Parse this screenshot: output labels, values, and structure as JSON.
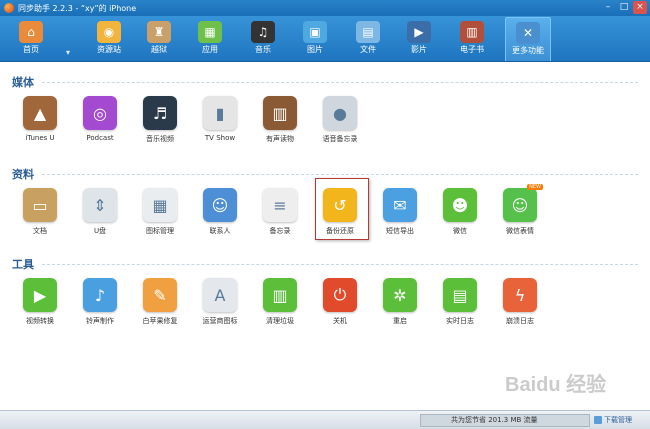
{
  "window": {
    "title": "同步助手 2.2.3 - “xy”的 iPhone",
    "min": "–",
    "max": "□",
    "close": "×"
  },
  "toolbar": {
    "items": [
      {
        "label": "首页",
        "icon": "home-icon",
        "color": "#e98b3a",
        "glyph": "⌂"
      },
      {
        "label": "资源站",
        "icon": "store-icon",
        "color": "#f2b43c",
        "glyph": "◉"
      },
      {
        "label": "越狱",
        "icon": "jailbreak-icon",
        "color": "#c9a06a",
        "glyph": "♜"
      },
      {
        "label": "应用",
        "icon": "apps-icon",
        "color": "#6fbf4b",
        "glyph": "▦"
      },
      {
        "label": "音乐",
        "icon": "music-icon",
        "color": "#333333",
        "glyph": "♫"
      },
      {
        "label": "图片",
        "icon": "photo-icon",
        "color": "#4fa9e0",
        "glyph": "▣"
      },
      {
        "label": "文件",
        "icon": "folder-icon",
        "color": "#7db7e6",
        "glyph": "▤"
      },
      {
        "label": "影片",
        "icon": "video-icon",
        "color": "#3b6ea8",
        "glyph": "▶"
      },
      {
        "label": "电子书",
        "icon": "ebook-icon",
        "color": "#b0503a",
        "glyph": "▥"
      },
      {
        "label": "更多功能",
        "icon": "more-tools-icon",
        "color": "#4a8fd0",
        "glyph": "✕"
      }
    ],
    "dropdown": "▾"
  },
  "sections": [
    {
      "title": "媒体",
      "tiles": [
        {
          "label": "iTunes U",
          "icon": "itunes-u-icon",
          "color": "#a0673a",
          "glyph": "▲"
        },
        {
          "label": "Podcast",
          "icon": "podcast-icon",
          "color": "#a34ad0",
          "glyph": "◎"
        },
        {
          "label": "音乐视频",
          "icon": "music-video-icon",
          "color": "#2b3a4a",
          "glyph": "♬"
        },
        {
          "label": "TV Show",
          "icon": "tv-show-icon",
          "color": "#e5e5e5",
          "glyph": "▮"
        },
        {
          "label": "有声读物",
          "icon": "audiobook-icon",
          "color": "#8a5a35",
          "glyph": "▥"
        },
        {
          "label": "语音备忘录",
          "icon": "voice-memo-icon",
          "color": "#cfd6dd",
          "glyph": "●"
        }
      ]
    },
    {
      "title": "资料",
      "tiles": [
        {
          "label": "文档",
          "icon": "document-icon",
          "color": "#c8a060",
          "glyph": "▭"
        },
        {
          "label": "U盘",
          "icon": "usb-disk-icon",
          "color": "#dfe4e8",
          "glyph": "⇕"
        },
        {
          "label": "图标管理",
          "icon": "icon-manage-icon",
          "color": "#e9edf0",
          "glyph": "▦"
        },
        {
          "label": "联系人",
          "icon": "contacts-icon",
          "color": "#4d8fd6",
          "glyph": "☺"
        },
        {
          "label": "备忘录",
          "icon": "notes-icon",
          "color": "#eeeeee",
          "glyph": "≡"
        },
        {
          "label": "备份还原",
          "icon": "backup-restore-icon",
          "color": "#f2b51c",
          "glyph": "↺"
        },
        {
          "label": "短信导出",
          "icon": "sms-export-icon",
          "color": "#4aa0e0",
          "glyph": "✉"
        },
        {
          "label": "微信",
          "icon": "wechat-icon",
          "color": "#5bbf3a",
          "glyph": "☻"
        },
        {
          "label": "微信表情",
          "icon": "wechat-sticker-icon",
          "color": "#55c04a",
          "glyph": "☺",
          "badge": "NEW"
        }
      ]
    },
    {
      "title": "工具",
      "tiles": [
        {
          "label": "视频转换",
          "icon": "video-convert-icon",
          "color": "#5bbf3a",
          "glyph": "▶"
        },
        {
          "label": "铃声制作",
          "icon": "ringtone-icon",
          "color": "#4a9fe0",
          "glyph": "♪"
        },
        {
          "label": "白苹果修复",
          "icon": "repair-icon",
          "color": "#f0a040",
          "glyph": "✎"
        },
        {
          "label": "运营商图标",
          "icon": "carrier-icon",
          "color": "#e4e8ec",
          "glyph": "A"
        },
        {
          "label": "清理垃圾",
          "icon": "clean-junk-icon",
          "color": "#5bbf3a",
          "glyph": "▥"
        },
        {
          "label": "关机",
          "icon": "power-off-icon",
          "color": "#e14b2c",
          "glyph": "⏻"
        },
        {
          "label": "重启",
          "icon": "restart-icon",
          "color": "#5bbf3a",
          "glyph": "✲"
        },
        {
          "label": "实时日志",
          "icon": "realtime-log-icon",
          "color": "#5bbf3a",
          "glyph": "▤"
        },
        {
          "label": "崩溃日志",
          "icon": "crash-log-icon",
          "color": "#e8623a",
          "glyph": "ϟ"
        }
      ]
    }
  ],
  "status": {
    "traffic": "共为您节省  201.3 MB 流量",
    "download_manager": "下载管理"
  },
  "watermark": "Baidu 经验"
}
